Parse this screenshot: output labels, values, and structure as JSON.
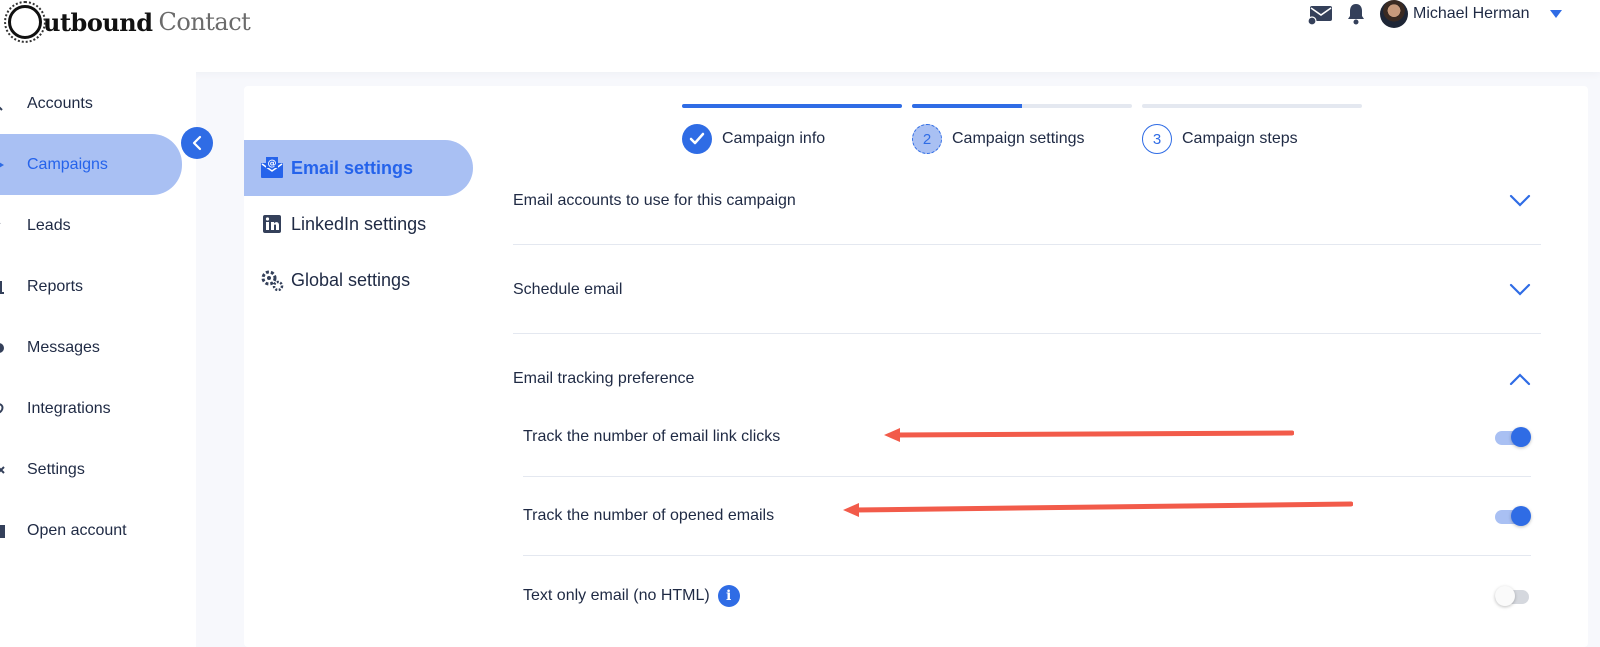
{
  "brand": {
    "part1": "utbound",
    "part2": "Contact"
  },
  "user": {
    "name": "Michael Herman"
  },
  "nav": {
    "items": [
      {
        "label": "Accounts",
        "icon": "accounts-icon"
      },
      {
        "label": "Campaigns",
        "icon": "campaigns-icon",
        "active": true
      },
      {
        "label": "Leads",
        "icon": "leads-icon"
      },
      {
        "label": "Reports",
        "icon": "reports-icon"
      },
      {
        "label": "Messages",
        "icon": "messages-icon"
      },
      {
        "label": "Integrations",
        "icon": "integrations-icon"
      },
      {
        "label": "Settings",
        "icon": "settings-icon"
      },
      {
        "label": "Open account",
        "icon": "open-account-icon"
      }
    ]
  },
  "settings_menu": {
    "email": "Email settings",
    "linkedin": "LinkedIn settings",
    "global": "Global settings"
  },
  "stepper": {
    "steps": [
      {
        "label": "Campaign info",
        "state": "done",
        "progress": 1.0
      },
      {
        "label": "Campaign settings",
        "number": "2",
        "state": "current",
        "progress": 0.5
      },
      {
        "label": "Campaign steps",
        "number": "3",
        "state": "todo",
        "progress": 0.0
      }
    ]
  },
  "sections": {
    "email_accounts": "Email accounts to use for this campaign",
    "schedule": "Schedule email",
    "tracking": "Email tracking preference"
  },
  "tracking": {
    "link_clicks": {
      "label": "Track the number of email link clicks",
      "enabled": true
    },
    "opened": {
      "label": "Track the number of opened emails",
      "enabled": true
    },
    "text_only": {
      "label": "Text only email (no HTML)",
      "enabled": false
    }
  },
  "colors": {
    "accent": "#2f6ce5",
    "accent_light": "#a9c0f3",
    "annotation_arrow": "#f25b4a"
  }
}
